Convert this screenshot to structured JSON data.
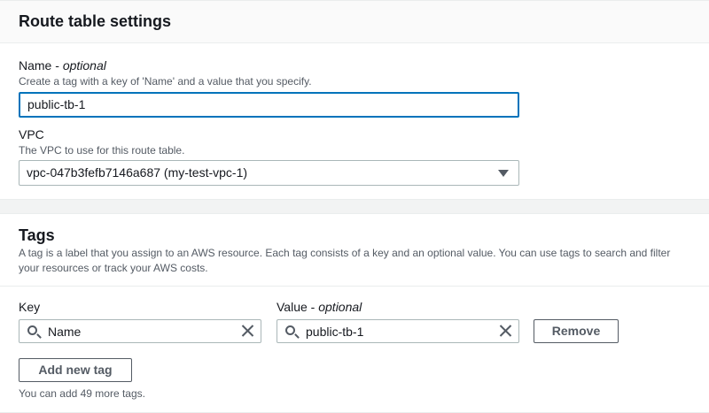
{
  "route_table_settings": {
    "title": "Route table settings",
    "name_label": "Name",
    "name_optional": "optional",
    "name_description": "Create a tag with a key of 'Name' and a value that you specify.",
    "name_value": "public-tb-1",
    "vpc_label": "VPC",
    "vpc_description": "The VPC to use for this route table.",
    "vpc_selected": "vpc-047b3fefb7146a687 (my-test-vpc-1)"
  },
  "tags": {
    "title": "Tags",
    "description": "A tag is a label that you assign to an AWS resource. Each tag consists of a key and an optional value. You can use tags to search and filter your resources or track your AWS costs.",
    "key_header": "Key",
    "value_header": "Value",
    "value_optional": "optional",
    "rows": [
      {
        "key": "Name",
        "value": "public-tb-1",
        "remove_label": "Remove"
      }
    ],
    "add_button_label": "Add new tag",
    "remaining_hint": "You can add 49 more tags."
  },
  "colors": {
    "focus_border": "#0073bb",
    "text_primary": "#16191f",
    "text_secondary": "#545b64",
    "page_background": "#f2f3f3"
  },
  "icons": {
    "search": "search-icon",
    "clear": "close-icon",
    "dropdown": "caret-down-icon"
  }
}
